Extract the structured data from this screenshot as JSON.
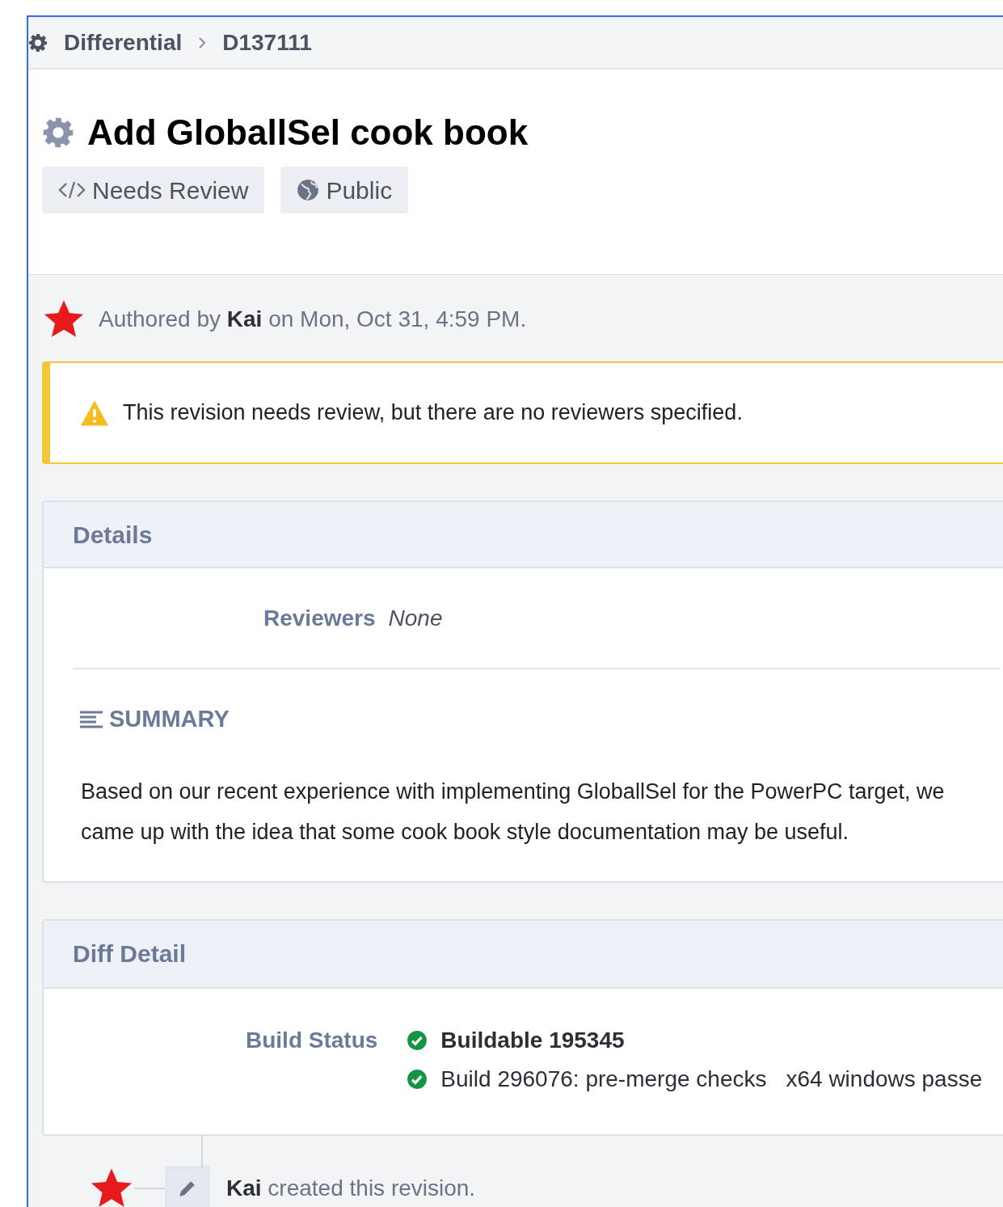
{
  "breadcrumbs": [
    {
      "label": "Differential"
    },
    {
      "label": "D137111"
    }
  ],
  "title": "Add GloballSel cook book",
  "tags": [
    {
      "kind": "code",
      "label": "Needs Review"
    },
    {
      "kind": "globe",
      "label": "Public"
    }
  ],
  "authored": "Authored by **Kai** on Mon, Oct 31, 4:59 PM.",
  "warning": "This revision needs review, but there are no reviewers specified.",
  "details": {
    "header": "Details",
    "reviewers_label": "Reviewers",
    "reviewers_value": "None",
    "summary_heading": "SUMMARY",
    "summary": "Based on our recent experience with implementing GloballSel for the PowerPC target, we came up with the idea that some cook book style documentation may be useful."
  },
  "diff_detail": {
    "header": "Diff Detail",
    "label": "Build Status",
    "items": [
      {
        "kind": "buildable",
        "text": "Buildable 195345"
      },
      {
        "kind": "build",
        "text": "Build 296076: pre-merge checks",
        "extra": "x64 windows passe"
      }
    ]
  },
  "timeline": [
    {
      "text": "**Kai** created this revision."
    }
  ]
}
